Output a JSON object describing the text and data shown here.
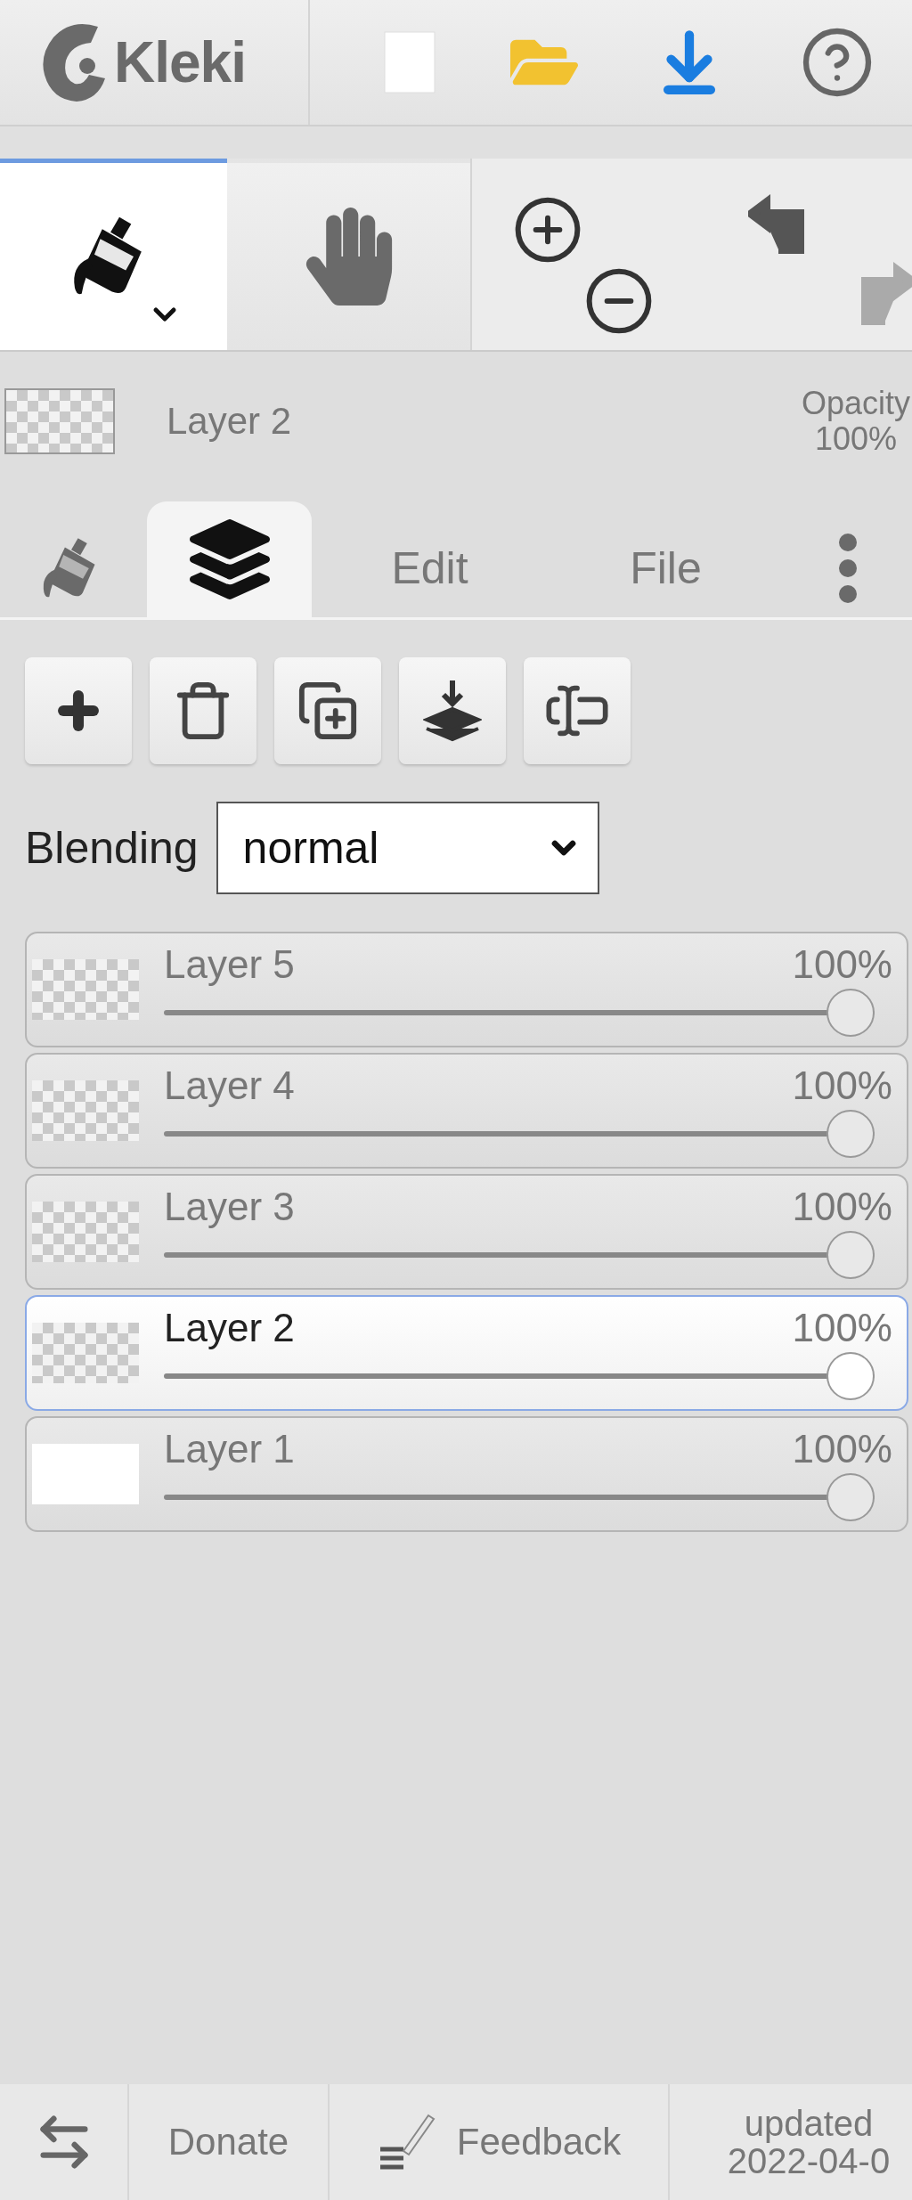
{
  "header": {
    "logo": "Kleki"
  },
  "tools": [
    {
      "kind": "bucket",
      "selected": true
    },
    {
      "kind": "hand",
      "selected": false
    }
  ],
  "history": [
    {
      "kind": "undo",
      "disabled": false
    },
    {
      "kind": "redo",
      "disabled": true
    }
  ],
  "current_layer": {
    "name": "Layer 2",
    "opacity_label": "Opacity",
    "opacity": "100%"
  },
  "tabs": [
    {
      "kind": "bucket",
      "selected": false
    },
    {
      "kind": "layers",
      "selected": true
    },
    {
      "kind": "text",
      "label": "Edit",
      "selected": false
    },
    {
      "kind": "text",
      "label": "File",
      "selected": false
    },
    {
      "kind": "more",
      "selected": false
    }
  ],
  "blending": {
    "label": "Blending",
    "value": "normal"
  },
  "layers": [
    {
      "name": "Layer 5",
      "opacity": "100%",
      "level": 1,
      "selected": false,
      "opaque": false
    },
    {
      "name": "Layer 4",
      "opacity": "100%",
      "level": 1,
      "selected": false,
      "opaque": false
    },
    {
      "name": "Layer 3",
      "opacity": "100%",
      "level": 1,
      "selected": false,
      "opaque": false
    },
    {
      "name": "Layer 2",
      "opacity": "100%",
      "level": 1,
      "selected": true,
      "opaque": false
    },
    {
      "name": "Layer 1",
      "opacity": "100%",
      "level": 1,
      "selected": false,
      "opaque": true
    }
  ],
  "footer": {
    "donate": "Donate",
    "feedback": "Feedback",
    "updated_label": "updated",
    "updated_date": "2022-04-0"
  }
}
